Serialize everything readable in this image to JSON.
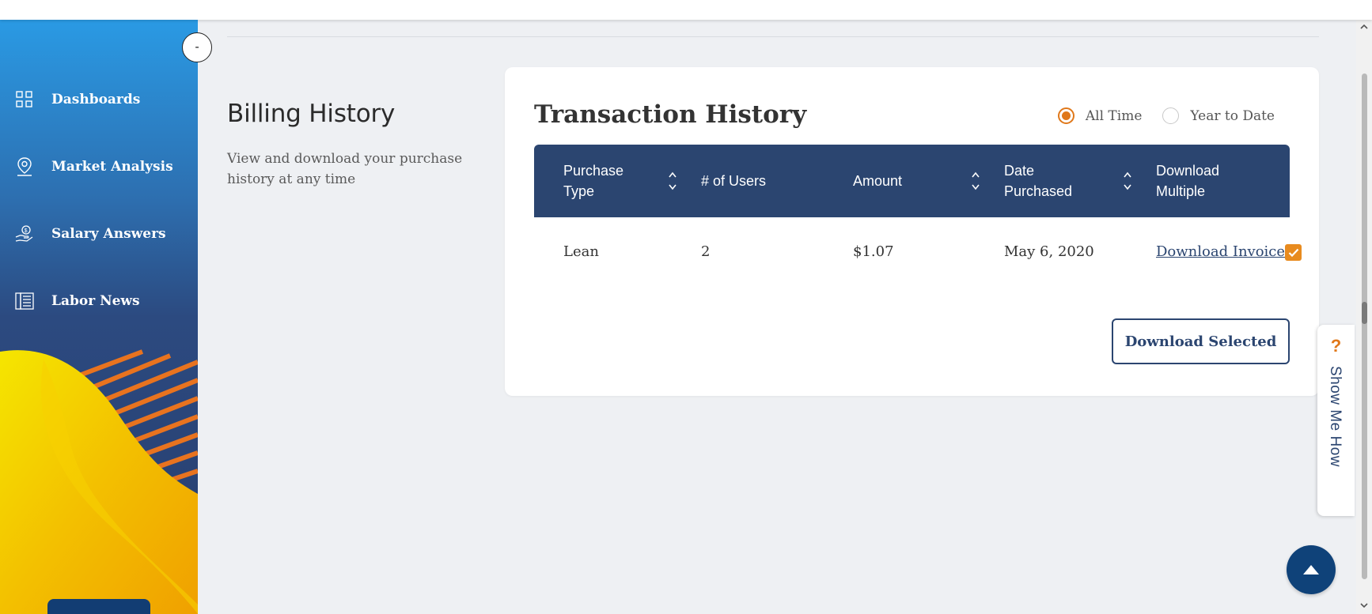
{
  "sidebar": {
    "items": [
      {
        "label": "Dashboards",
        "icon": "dashboard-grid-icon"
      },
      {
        "label": "Market Analysis",
        "icon": "map-pin-icon"
      },
      {
        "label": "Salary Answers",
        "icon": "hand-dollar-icon"
      },
      {
        "label": "Labor News",
        "icon": "newspaper-icon"
      }
    ],
    "collapse_label": "-"
  },
  "billing": {
    "title": "Billing History",
    "description": "View and download your purchase history at any time"
  },
  "transactions": {
    "title": "Transaction History",
    "filters": [
      {
        "label": "All Time",
        "selected": true
      },
      {
        "label": "Year to Date",
        "selected": false
      }
    ],
    "columns": [
      {
        "label": "Purchase Type",
        "sortable": true
      },
      {
        "label": "# of Users",
        "sortable": false
      },
      {
        "label": "Amount",
        "sortable": true
      },
      {
        "label": "Date Purchased",
        "sortable": true
      },
      {
        "label": "Download Multiple",
        "sortable": false
      }
    ],
    "rows": [
      {
        "purchase_type": "Lean",
        "users": "2",
        "amount": "$1.07",
        "date": "May 6, 2020",
        "link": "Download Invoice",
        "selected": true
      }
    ],
    "download_selected_label": "Download Selected"
  },
  "help": {
    "icon": "?",
    "label": "Show Me How"
  },
  "colors": {
    "accent_orange": "#e0781a",
    "navy": "#2b4570",
    "sidebar_blue": "#2a9ae4",
    "background": "#eef0f3"
  },
  "icons": [
    "scroll-to-top-icon",
    "sort-arrows-icon",
    "checkmark-icon"
  ]
}
